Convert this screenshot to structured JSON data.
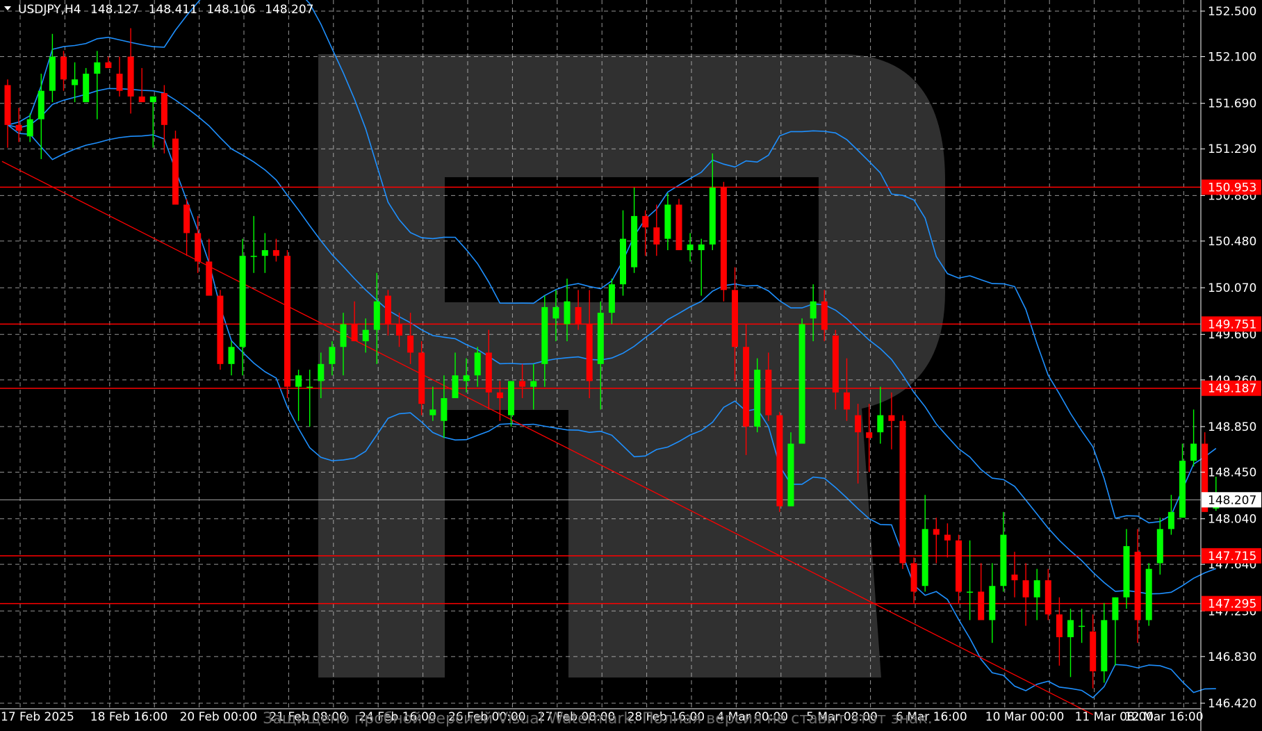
{
  "header": {
    "symbol": "USDJPY,H4",
    "open": "148.127",
    "high": "148.411",
    "low": "148.106",
    "close": "148.207",
    "arrow_icon": "triangle-down-icon"
  },
  "watermark_text": "Защищено пробной версией Visual Watermark. Полная версия не ставит этот знак.",
  "colors": {
    "background": "#000000",
    "grid": "#c8c8c8",
    "bull": "#00ff00",
    "bear": "#ff0000",
    "bollinger": "#1e90ff",
    "level_lines": "#ff0000",
    "trendline": "#ff0000",
    "current_price_line": "#aaaaaa",
    "axis_text": "#ffffff",
    "logo": "#3a3a3a"
  },
  "chart_data": {
    "type": "candlestick",
    "title": "USDJPY,H4",
    "timeframe": "H4",
    "ylim": [
      146.42,
      152.5
    ],
    "y_ticks": [
      "152.500",
      "152.100",
      "151.690",
      "151.290",
      "150.880",
      "150.480",
      "150.070",
      "149.660",
      "149.260",
      "148.850",
      "148.450",
      "148.040",
      "147.640",
      "147.230",
      "146.830",
      "146.420"
    ],
    "x_labels": [
      "17 Feb 2025",
      "18 Feb 16:00",
      "20 Feb 00:00",
      "21 Feb 08:00",
      "24 Feb 16:00",
      "26 Feb 00:00",
      "27 Feb 08:00",
      "28 Feb 16:00",
      "4 Mar 00:00",
      "5 Mar 08:00",
      "6 Mar 16:00",
      "10 Mar 00:00",
      "11 Mar 08:00",
      "12 Mar 16:00"
    ],
    "x_label_bar_index": [
      0,
      8,
      16,
      24,
      32,
      40,
      48,
      56,
      64,
      72,
      80,
      88,
      96,
      104
    ],
    "grid": true,
    "level_lines": [
      {
        "price": 150.953,
        "label": "150.953"
      },
      {
        "price": 149.751,
        "label": "149.751"
      },
      {
        "price": 149.187,
        "label": "149.187"
      },
      {
        "price": 147.715,
        "label": "147.715"
      },
      {
        "price": 147.295,
        "label": "147.295"
      }
    ],
    "current_price": {
      "price": 148.207,
      "label": "148.207"
    },
    "trendline": {
      "from": {
        "bar": -0.5,
        "price": 151.18
      },
      "to": {
        "bar": 97,
        "price": 146.32
      }
    },
    "candles": [
      [
        151.85,
        151.9,
        151.3,
        151.5
      ],
      [
        151.5,
        151.65,
        151.35,
        151.45
      ],
      [
        151.4,
        151.6,
        151.35,
        151.55
      ],
      [
        151.55,
        151.95,
        151.2,
        151.8
      ],
      [
        151.8,
        152.3,
        151.7,
        152.1
      ],
      [
        152.1,
        152.15,
        151.8,
        151.9
      ],
      [
        151.85,
        152.05,
        151.7,
        151.9
      ],
      [
        151.7,
        152.0,
        151.7,
        151.95
      ],
      [
        151.95,
        152.15,
        151.55,
        152.05
      ],
      [
        152.05,
        152.1,
        152.0,
        152.0
      ],
      [
        151.95,
        152.1,
        151.75,
        151.8
      ],
      [
        152.1,
        152.35,
        151.6,
        151.75
      ],
      [
        151.75,
        152.0,
        151.7,
        151.7
      ],
      [
        151.7,
        151.75,
        151.3,
        151.75
      ],
      [
        151.78,
        151.85,
        151.25,
        151.5
      ],
      [
        151.38,
        151.45,
        150.9,
        150.8
      ],
      [
        150.8,
        150.85,
        150.35,
        150.55
      ],
      [
        150.55,
        150.7,
        150.2,
        150.3
      ],
      [
        150.3,
        150.5,
        150.05,
        150.0
      ],
      [
        150.0,
        150.05,
        149.35,
        149.4
      ],
      [
        149.4,
        149.6,
        149.3,
        149.55
      ],
      [
        149.55,
        150.5,
        149.3,
        150.35
      ],
      [
        150.35,
        150.7,
        150.2,
        150.35
      ],
      [
        150.35,
        150.55,
        150.2,
        150.4
      ],
      [
        150.4,
        150.5,
        150.3,
        150.35
      ],
      [
        150.35,
        150.4,
        149.1,
        149.2
      ],
      [
        149.2,
        149.35,
        148.9,
        149.3
      ],
      [
        149.2,
        149.35,
        148.85,
        149.2
      ],
      [
        149.25,
        149.5,
        149.1,
        149.4
      ],
      [
        149.4,
        149.6,
        149.3,
        149.55
      ],
      [
        149.55,
        149.85,
        149.3,
        149.75
      ],
      [
        149.75,
        149.95,
        149.6,
        149.6
      ],
      [
        149.6,
        149.8,
        149.5,
        149.7
      ],
      [
        149.7,
        150.2,
        149.4,
        149.95
      ],
      [
        150.0,
        150.05,
        149.65,
        149.75
      ],
      [
        149.75,
        149.85,
        149.55,
        149.65
      ],
      [
        149.65,
        149.85,
        149.4,
        149.5
      ],
      [
        149.5,
        149.6,
        148.95,
        149.05
      ],
      [
        148.95,
        149.2,
        148.9,
        149.0
      ],
      [
        148.9,
        149.3,
        148.75,
        149.1
      ],
      [
        149.1,
        149.5,
        149.1,
        149.3
      ],
      [
        149.25,
        149.45,
        149.15,
        149.3
      ],
      [
        149.3,
        149.55,
        149.2,
        149.5
      ],
      [
        149.5,
        149.7,
        149.0,
        149.15
      ],
      [
        149.15,
        149.25,
        148.9,
        149.1
      ],
      [
        148.95,
        149.25,
        148.85,
        149.25
      ],
      [
        149.25,
        149.4,
        149.1,
        149.2
      ],
      [
        149.2,
        149.4,
        149.0,
        149.25
      ],
      [
        149.4,
        150.0,
        149.2,
        149.9
      ],
      [
        149.8,
        150.05,
        149.6,
        149.9
      ],
      [
        149.75,
        150.15,
        149.6,
        149.95
      ],
      [
        149.9,
        150.05,
        149.7,
        149.75
      ],
      [
        149.75,
        150.05,
        149.1,
        149.25
      ],
      [
        149.4,
        149.95,
        149.0,
        149.85
      ],
      [
        149.85,
        150.15,
        149.75,
        150.1
      ],
      [
        150.1,
        150.75,
        150.0,
        150.5
      ],
      [
        150.25,
        150.95,
        150.2,
        150.7
      ],
      [
        150.7,
        150.75,
        150.35,
        150.6
      ],
      [
        150.6,
        150.8,
        150.35,
        150.45
      ],
      [
        150.5,
        150.9,
        150.4,
        150.8
      ],
      [
        150.8,
        150.85,
        150.5,
        150.4
      ],
      [
        150.4,
        150.55,
        150.3,
        150.45
      ],
      [
        150.4,
        150.5,
        150.0,
        150.45
      ],
      [
        150.45,
        151.25,
        150.4,
        150.95
      ],
      [
        150.95,
        151.0,
        149.95,
        150.05
      ],
      [
        150.05,
        150.25,
        149.25,
        149.55
      ],
      [
        149.55,
        149.75,
        148.6,
        148.85
      ],
      [
        148.85,
        149.45,
        148.8,
        149.35
      ],
      [
        149.35,
        149.5,
        148.9,
        148.95
      ],
      [
        148.95,
        148.98,
        148.1,
        148.15
      ],
      [
        148.15,
        148.8,
        148.15,
        148.7
      ],
      [
        148.7,
        149.8,
        148.7,
        149.75
      ],
      [
        149.8,
        150.1,
        149.6,
        149.95
      ],
      [
        149.95,
        150.05,
        149.6,
        149.7
      ],
      [
        149.65,
        149.7,
        149.0,
        149.15
      ],
      [
        149.15,
        149.45,
        148.9,
        149.0
      ],
      [
        148.95,
        149.05,
        148.35,
        148.8
      ],
      [
        148.8,
        149.05,
        148.45,
        148.75
      ],
      [
        148.8,
        149.2,
        148.7,
        148.95
      ],
      [
        148.95,
        149.15,
        148.65,
        148.9
      ],
      [
        148.9,
        148.95,
        147.6,
        147.65
      ],
      [
        147.65,
        147.7,
        147.3,
        147.4
      ],
      [
        147.45,
        148.25,
        147.4,
        147.95
      ],
      [
        147.95,
        148.05,
        147.65,
        147.9
      ],
      [
        147.9,
        148.0,
        147.7,
        147.85
      ],
      [
        147.85,
        147.9,
        147.3,
        147.4
      ],
      [
        147.4,
        147.85,
        147.15,
        147.4
      ],
      [
        147.4,
        147.65,
        147.2,
        147.15
      ],
      [
        147.15,
        147.65,
        146.95,
        147.45
      ],
      [
        147.45,
        148.1,
        147.4,
        147.9
      ],
      [
        147.55,
        147.75,
        147.35,
        147.5
      ],
      [
        147.5,
        147.65,
        147.1,
        147.35
      ],
      [
        147.35,
        147.6,
        147.15,
        147.5
      ],
      [
        147.5,
        147.6,
        147.15,
        147.2
      ],
      [
        147.2,
        147.35,
        146.75,
        147.0
      ],
      [
        147.0,
        147.25,
        146.65,
        147.15
      ],
      [
        147.1,
        147.25,
        146.95,
        147.1
      ],
      [
        147.05,
        147.2,
        146.55,
        146.7
      ],
      [
        146.7,
        147.3,
        146.6,
        147.15
      ],
      [
        147.15,
        147.35,
        146.75,
        147.35
      ],
      [
        147.35,
        147.95,
        147.25,
        147.8
      ],
      [
        147.75,
        147.95,
        146.95,
        147.15
      ],
      [
        147.15,
        147.65,
        147.1,
        147.6
      ],
      [
        147.65,
        148.05,
        147.55,
        147.95
      ],
      [
        147.95,
        148.25,
        147.9,
        148.1
      ],
      [
        148.05,
        148.7,
        148.05,
        148.55
      ],
      [
        148.55,
        149.0,
        148.5,
        148.7
      ],
      [
        148.7,
        148.8,
        148.1,
        148.1
      ],
      [
        148.13,
        148.41,
        148.11,
        148.21
      ]
    ]
  }
}
